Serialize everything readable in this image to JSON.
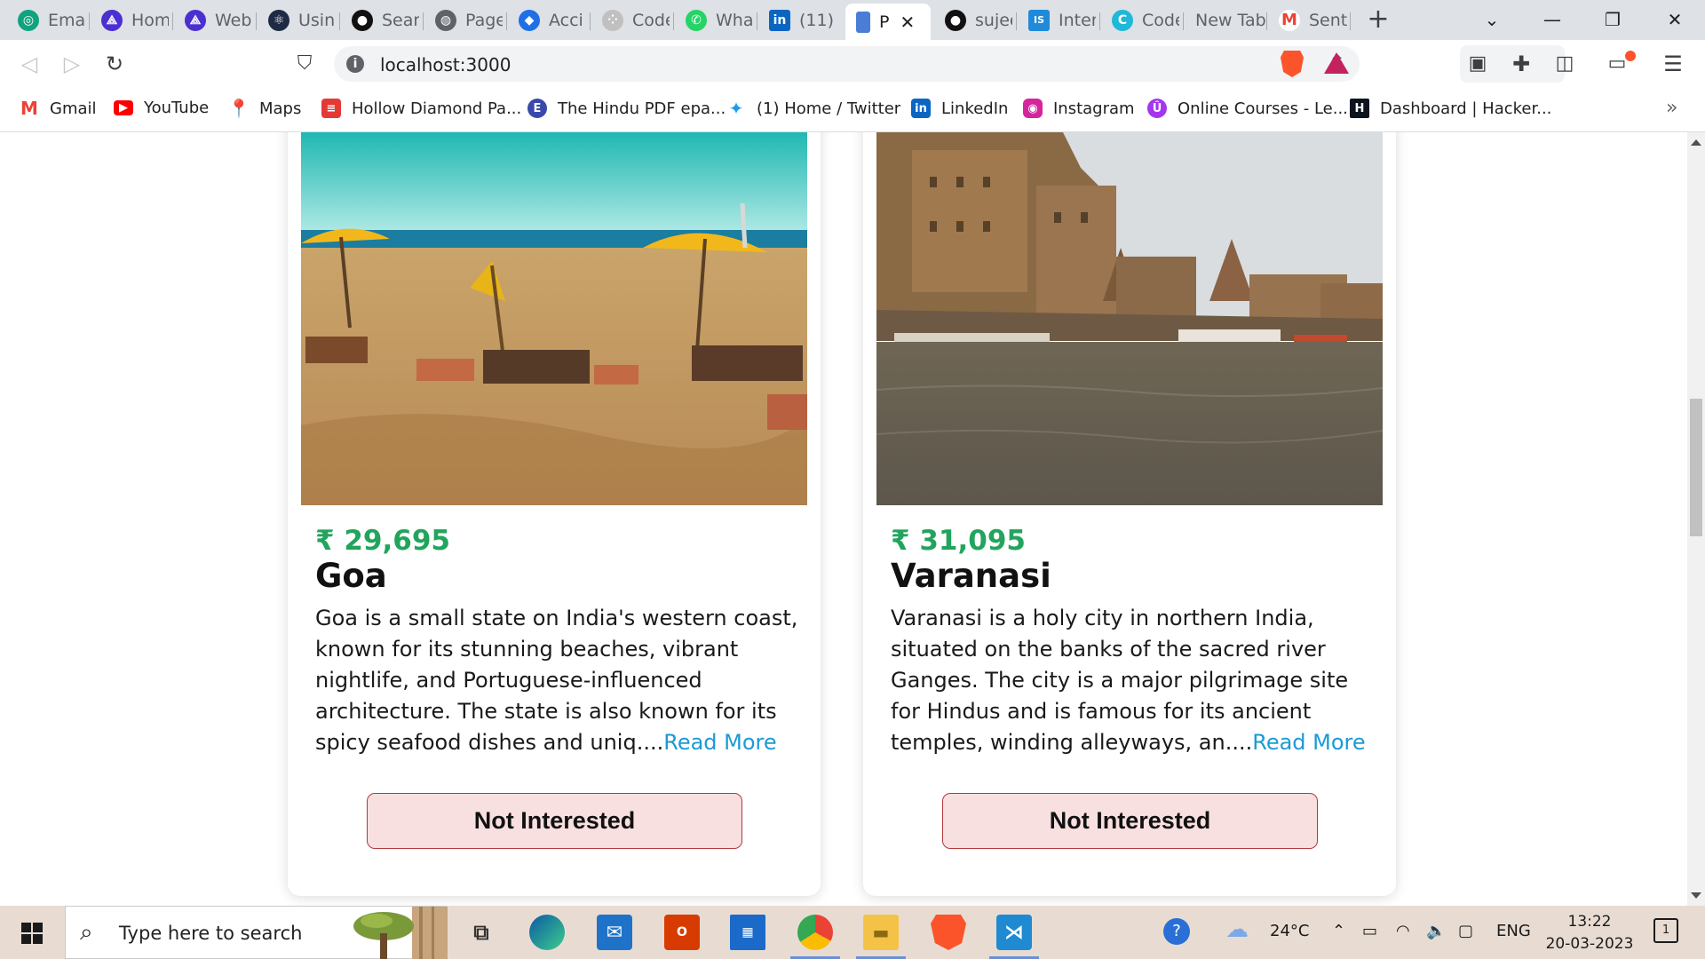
{
  "browser": {
    "tabs": [
      {
        "label": "Email",
        "icon": "openai-icon",
        "color": "#10a37f",
        "glyph": "◎"
      },
      {
        "label": "Home",
        "icon": "scaler-icon",
        "color": "#4b2fd1",
        "glyph": "⟁"
      },
      {
        "label": "Web",
        "icon": "scaler-icon",
        "color": "#4b2fd1",
        "glyph": "⟁"
      },
      {
        "label": "Using",
        "icon": "react-icon",
        "color": "#1f2a44",
        "glyph": "⚛"
      },
      {
        "label": "Search",
        "icon": "github-icon",
        "color": "#111111",
        "glyph": "●"
      },
      {
        "label": "Page",
        "icon": "globe-icon",
        "color": "#5f6368",
        "glyph": "◍"
      },
      {
        "label": "Acci",
        "icon": "atlassian-icon",
        "color": "#1f6fe5",
        "glyph": "◆"
      },
      {
        "label": "Code",
        "icon": "codepen-icon",
        "color": "#c0c0c0",
        "glyph": "⁘"
      },
      {
        "label": "What",
        "icon": "whatsapp-icon",
        "color": "#25d366",
        "glyph": "✆"
      },
      {
        "label": "(11)",
        "icon": "linkedin-icon",
        "color": "#0a66c2",
        "glyph": "in"
      },
      {
        "label": "P",
        "icon": "page-icon",
        "color": "#4a7dd6",
        "glyph": "▮"
      },
      {
        "label": "sujee",
        "icon": "github-icon",
        "color": "#111111",
        "glyph": "●"
      },
      {
        "label": "Inter",
        "icon": "interviewbit-icon",
        "color": "#1f8ad8",
        "glyph": "IS"
      },
      {
        "label": "Code",
        "icon": "cc-icon",
        "color": "#1fb8d8",
        "glyph": "C"
      },
      {
        "label": "New Tab",
        "icon": "",
        "color": "",
        "glyph": ""
      },
      {
        "label": "Sent",
        "icon": "gmail-icon",
        "color": "#ea4335",
        "glyph": "M"
      }
    ],
    "active_tab_close": "✕",
    "new_tab": "+",
    "tab_search": "⌄",
    "minimize": "—",
    "restore": "❐",
    "close": "✕",
    "url": "localhost:3000",
    "bookmarks": [
      {
        "label": "Gmail",
        "icon": "gmail-icon",
        "color": "#ea4335",
        "glyph": "M"
      },
      {
        "label": "YouTube",
        "icon": "youtube-icon",
        "color": "#ff0000",
        "glyph": "▶"
      },
      {
        "label": "Maps",
        "icon": "maps-pin-icon",
        "color": "#34a853",
        "glyph": "⬤"
      },
      {
        "label": "Hollow Diamond Pa...",
        "icon": "bookmark-red-icon",
        "color": "#e53935",
        "glyph": "≡"
      },
      {
        "label": "The Hindu PDF epa...",
        "icon": "edge-e-icon",
        "color": "#3949ab",
        "glyph": "E"
      },
      {
        "label": "(1) Home / Twitter",
        "icon": "twitter-icon",
        "color": "#1d9bf0",
        "glyph": "✦"
      },
      {
        "label": "LinkedIn",
        "icon": "linkedin-icon",
        "color": "#0a66c2",
        "glyph": "in"
      },
      {
        "label": "Instagram",
        "icon": "instagram-icon",
        "color": "#d6249f",
        "glyph": "◉"
      },
      {
        "label": "Online Courses - Le...",
        "icon": "udemy-icon",
        "color": "#a435f0",
        "glyph": "Û"
      },
      {
        "label": "Dashboard | Hacker...",
        "icon": "hackerrank-icon",
        "color": "#0e141e",
        "glyph": "H"
      }
    ],
    "bookmarks_more": "»"
  },
  "page": {
    "cards": [
      {
        "price": "₹ 29,695",
        "name": "Goa",
        "description": "Goa is a small state on India's western coast, known for its stunning beaches, vibrant nightlife, and Portuguese-influenced architecture. The state is also known for its spicy seafood dishes and uniq....",
        "read_more": "Read More",
        "button": "Not Interested"
      },
      {
        "price": "₹ 31,095",
        "name": "Varanasi",
        "description": "Varanasi is a holy city in northern India, situated on the banks of the sacred river Ganges. The city is a major pilgrimage site for Hindus and is famous for its ancient temples, winding alleyways, an....",
        "read_more": "Read More",
        "button": "Not Interested"
      }
    ]
  },
  "taskbar": {
    "search_placeholder": "Type here to search",
    "temperature": "24°C",
    "language": "ENG",
    "time": "13:22",
    "date": "20-03-2023",
    "notification_count": "1"
  },
  "colors": {
    "price": "#22a45d",
    "read_more": "#1b9ad6",
    "button_bg": "#f8dfe0",
    "button_border": "#b33a3a"
  }
}
